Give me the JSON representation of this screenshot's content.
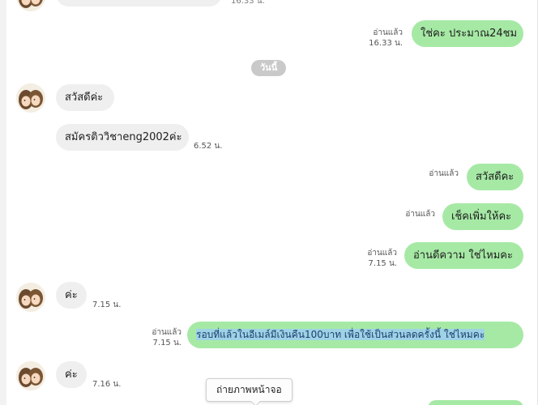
{
  "colors": {
    "incoming_bubble": "#efefef",
    "outgoing_bubble": "#a6e9a5",
    "date_separator": "#c9c9c9",
    "highlight": "#9ed3e6"
  },
  "top_partial": {
    "time": "16.33 น."
  },
  "messages": [
    {
      "direction": "out",
      "text": "ใช่คะ ประมาณ24ชม",
      "read": "อ่านแล้ว",
      "time": "16.33 น."
    },
    {
      "direction": "in",
      "text": "สวัสดีค่ะ",
      "avatar": "avatar-icon"
    },
    {
      "direction": "in",
      "text": "สมัครติววิชาeng2002ค่ะ",
      "time": "6.52 น."
    },
    {
      "direction": "out",
      "text": "สวัสดีคะ",
      "read": "อ่านแล้ว"
    },
    {
      "direction": "out",
      "text": "เช็คเพิ่มให้คะ",
      "read": "อ่านแล้ว"
    },
    {
      "direction": "out",
      "text": "อ่านดีความ ใช่ไหมคะ",
      "read": "อ่านแล้ว",
      "time": "7.15 น."
    },
    {
      "direction": "in",
      "text": "ค่ะ",
      "time": "7.15 น.",
      "avatar": "avatar-icon"
    },
    {
      "direction": "out",
      "text": "รอบที่แล้วในอีเมล์มีเงินคืน100บาท เพื่อใช้เป็นส่วนลดครั้งนี้ ใช่ไหมคะ",
      "read": "อ่านแล้ว",
      "time": "7.15 น.",
      "selected": true
    },
    {
      "direction": "in",
      "text": "ค่ะ",
      "time": "7.16 น.",
      "avatar": "avatar-icon"
    }
  ],
  "date_separator": "วันนี้",
  "tooltip": "ถ่ายภาพหน้าจอ"
}
